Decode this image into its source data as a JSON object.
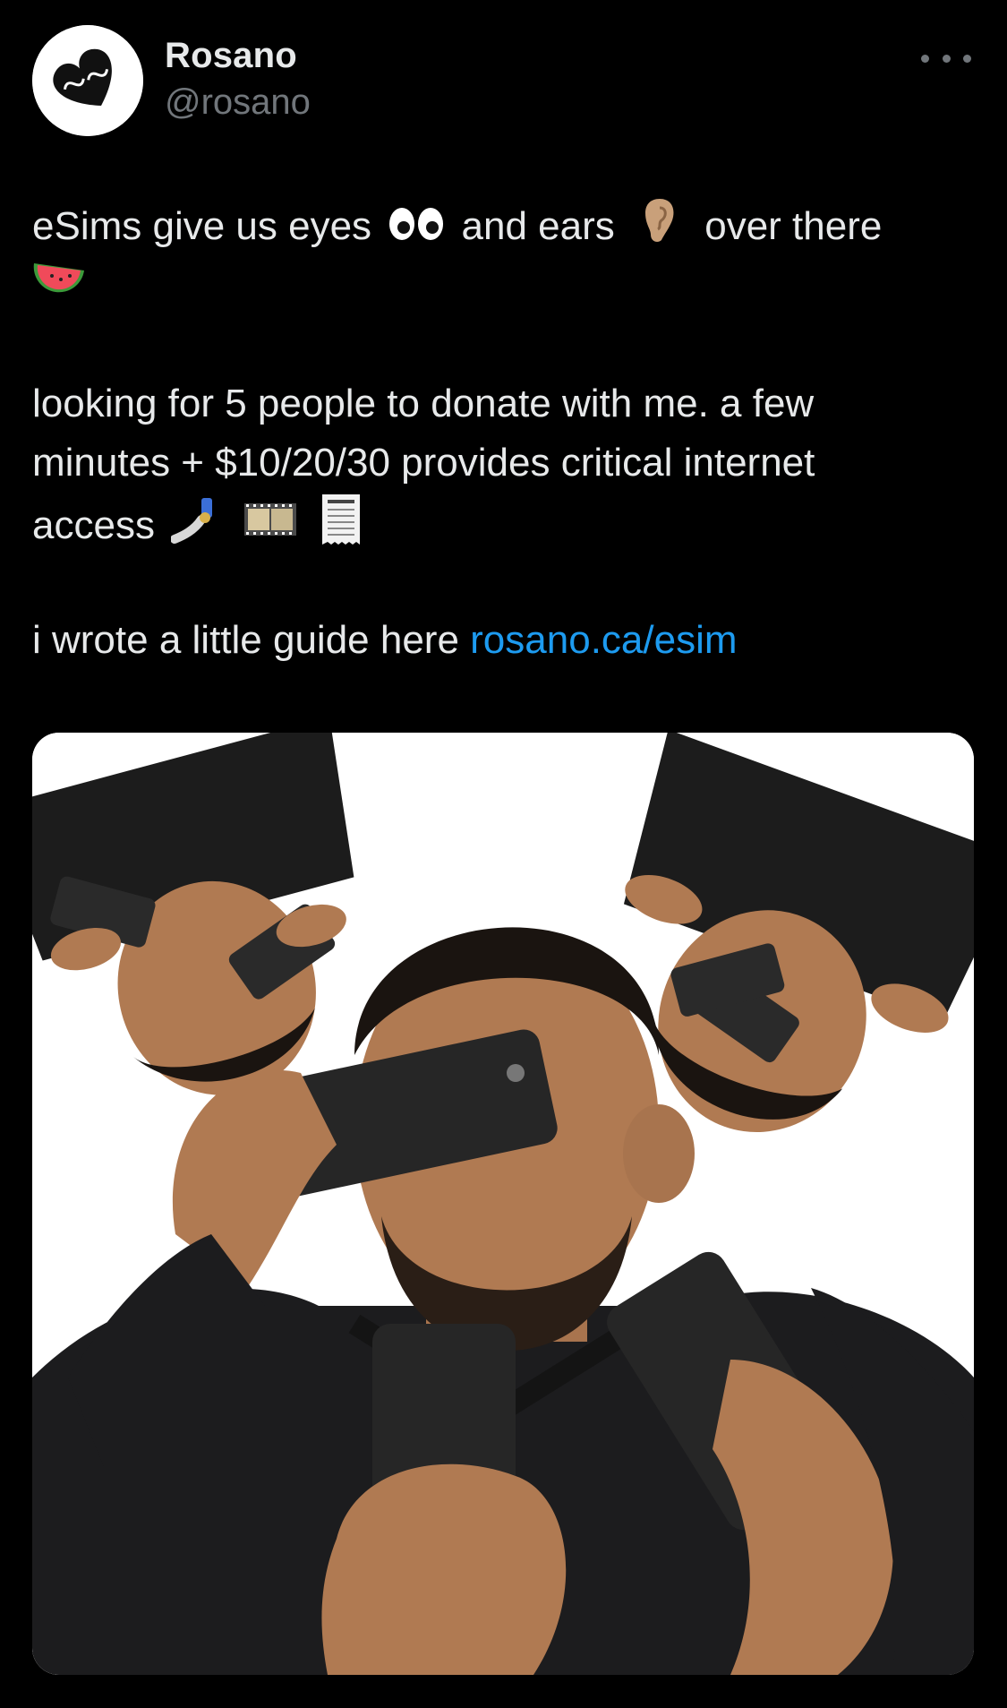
{
  "author": {
    "display_name": "Rosano",
    "handle": "@rosano",
    "avatar_icon": "puzzle-heart-icon"
  },
  "menu": {
    "more_icon": "more-horizontal-icon"
  },
  "tweet": {
    "line1_a": "eSims give us eyes",
    "line1_b": "and ears",
    "line1_c": "over there",
    "para2_line1": "looking for 5 people to donate with me. a few",
    "para2_line2": "minutes + $10/20/30 provides critical internet",
    "para2_line3": "access",
    "para3_text": "i wrote a little guide here ",
    "link_text": "rosano.ca/esim"
  },
  "media": {
    "icon": "photo-man-with-phones-collage"
  },
  "colors": {
    "background": "#000000",
    "text": "#e7e9ea",
    "muted": "#71767b",
    "link": "#1d9bf0"
  }
}
